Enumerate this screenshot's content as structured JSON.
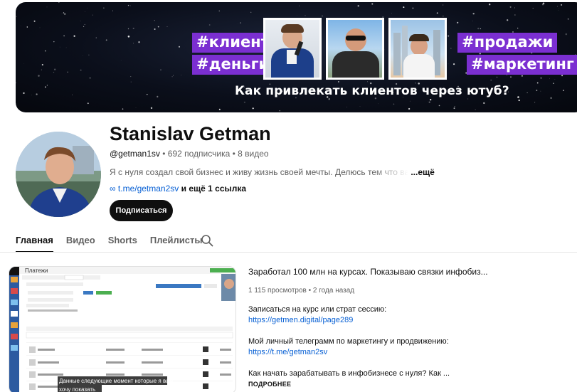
{
  "banner": {
    "tags": [
      "#клиенты",
      "#деньги",
      "#продажи",
      "#маркетинг"
    ],
    "caption": "Как привлекать клиентов через ютуб?",
    "accent": "#7b2fd1"
  },
  "channel": {
    "name": "Stanislav Getman",
    "handle": "@getman1sv",
    "subscribers": "692 подписчика",
    "videos": "8 видео",
    "description": "Я с нуля создал свой бизнес и живу жизнь своей мечты. Делюсь тем что важно для",
    "description_more": "...ещё",
    "link_url": "t.me/getman2sv",
    "link_more": "и ещё 1 ссылка",
    "subscribe_label": "Подписаться"
  },
  "tabs": [
    "Главная",
    "Видео",
    "Shorts",
    "Плейлисты"
  ],
  "featured": {
    "title": "Заработал 100 млн на курсах. Показываю связки инфобиз...",
    "views": "1 115 просмотров",
    "age": "2 года назад",
    "desc_1": "Записаться на курс или страт сессию:",
    "link_1": "https://getmen.digital/page289",
    "desc_2": "Мой личный телеграмм по маркетингу и продвижению:",
    "link_2": "https://t.me/getman2sv",
    "desc_3": "Как начать зарабатывать в инфобизнесе с нуля? Как ...",
    "more": "ПОДРОБНЕЕ",
    "thumb": {
      "page_title": "Платежи",
      "subtitle_1": "Данные следующие момент которые я вам",
      "subtitle_2": "хочу показать"
    }
  }
}
